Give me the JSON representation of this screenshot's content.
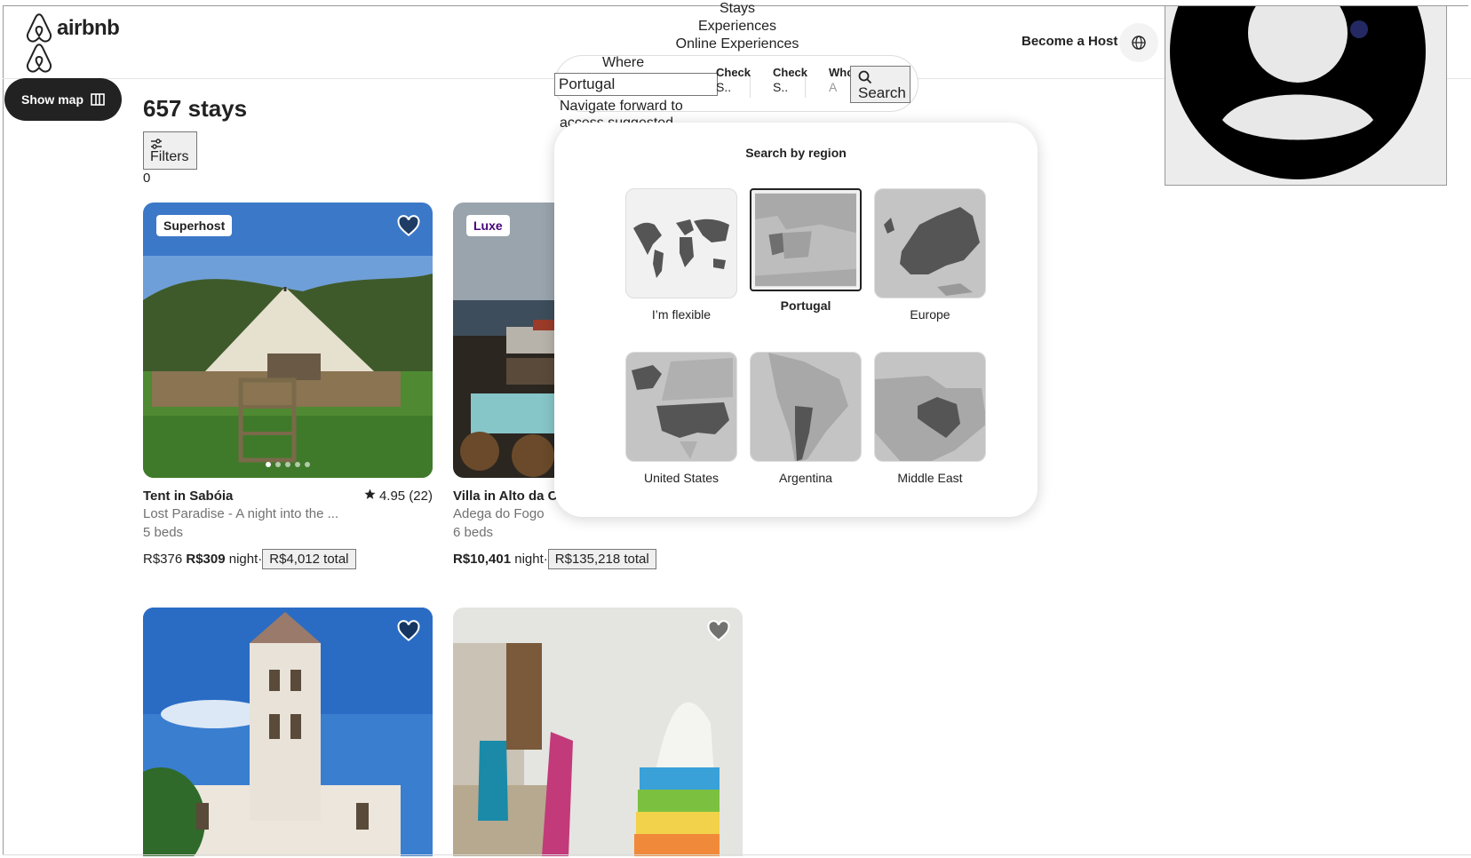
{
  "header": {
    "logo_text": "airbnb",
    "tabs": [
      "Stays",
      "Experiences",
      "Online Experiences"
    ],
    "become_host": "Become a Host"
  },
  "search": {
    "where_label": "Where",
    "where_value": "Portugal",
    "where_hint": "Navigate forward to access suggested",
    "checkin_label": "Check",
    "checkin_value": "S..",
    "checkout_label": "Check",
    "checkout_value": "S..",
    "who_label": "Who",
    "who_value": "A",
    "search_button": "Search"
  },
  "listing": {
    "show_map": "Show map",
    "stays_count": "657 stays",
    "filters_label": "Filters",
    "filters_count": "0",
    "cards": [
      {
        "badge": "Superhost",
        "title": "Tent in Sabóia",
        "rating": "4.95 (22)",
        "subtitle": "Lost Paradise -  A night into the ...",
        "beds": "5 beds",
        "old_price": "R$376",
        "price": "R$309",
        "per": "night·",
        "total": "R$4,012 total"
      },
      {
        "badge": "Luxe",
        "title": "Villa in Alto da C",
        "rating": "",
        "subtitle": "Adega do Fogo",
        "beds": "6 beds",
        "old_price": "",
        "price": "R$10,401",
        "per": "night·",
        "total": "R$135,218 total"
      },
      {
        "badge": "",
        "title": "",
        "rating": "",
        "subtitle": "",
        "beds": "",
        "price": "",
        "per": "",
        "total": ""
      },
      {
        "badge": "",
        "title": "",
        "rating": "",
        "subtitle": "",
        "beds": "",
        "price": "",
        "per": "",
        "total": ""
      }
    ]
  },
  "region_panel": {
    "title": "Search by region",
    "regions": [
      {
        "label": "I’m flexible",
        "selected": false
      },
      {
        "label": "Portugal",
        "selected": true
      },
      {
        "label": "Europe",
        "selected": false
      },
      {
        "label": "United States",
        "selected": false
      },
      {
        "label": "Argentina",
        "selected": false
      },
      {
        "label": "Middle East",
        "selected": false
      }
    ]
  },
  "icons": {
    "logo": "airbnb-belo-icon",
    "map": "map-icon",
    "filters": "sliders-icon",
    "search": "search-icon",
    "globe": "globe-icon",
    "heart": "heart-icon",
    "star": "star-icon",
    "avatar": "user-avatar-icon"
  },
  "colors": {
    "brand_text": "#222222",
    "luxe_badge": "#460479",
    "map_button_bg": "#222222",
    "muted_text": "#717171"
  }
}
